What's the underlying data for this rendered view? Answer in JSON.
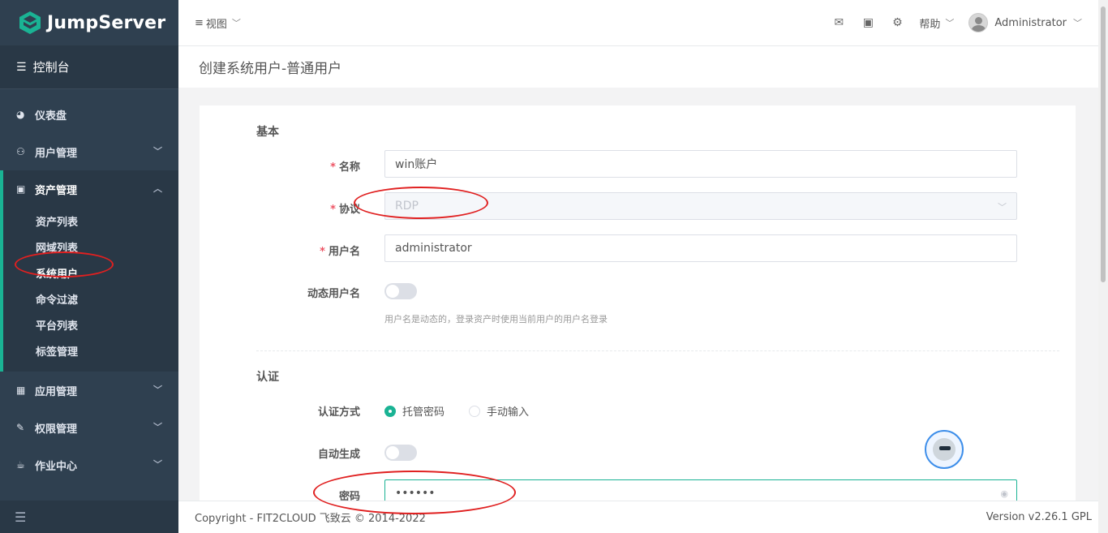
{
  "sidebar": {
    "logo_text": "JumpServer",
    "console_label": "控制台",
    "items": [
      {
        "label": "仪表盘",
        "icon": "dashboard-icon"
      },
      {
        "label": "用户管理",
        "icon": "users-icon"
      },
      {
        "label": "资产管理",
        "icon": "inbox-icon",
        "expanded": true
      },
      {
        "label": "应用管理",
        "icon": "grid-icon"
      },
      {
        "label": "权限管理",
        "icon": "edit-icon"
      },
      {
        "label": "作业中心",
        "icon": "coffee-icon"
      }
    ],
    "asset_sub": [
      "资产列表",
      "网域列表",
      "系统用户",
      "命令过滤",
      "平台列表",
      "标签管理"
    ],
    "active_sub": "系统用户"
  },
  "topbar": {
    "view_label": "视图",
    "help_label": "帮助",
    "user_name": "Administrator"
  },
  "page": {
    "title": "创建系统用户-普通用户"
  },
  "form": {
    "section_basic": "基本",
    "name_label": "名称",
    "name_value": "win账户",
    "protocol_label": "协议",
    "protocol_value": "RDP",
    "username_label": "用户名",
    "username_value": "administrator",
    "dynamic_user_label": "动态用户名",
    "dynamic_user_hint": "用户名是动态的，登录资产时使用当前用户的用户名登录",
    "section_auth": "认证",
    "auth_method_label": "认证方式",
    "auth_options": [
      "托管密码",
      "手动输入"
    ],
    "auth_selected": "托管密码",
    "auto_gen_label": "自动生成",
    "password_label": "密码",
    "password_value": "••••••"
  },
  "footer": {
    "copyright": "Copyright - FIT2CLOUD 飞致云 © 2014-2022",
    "version": "Version v2.26.1 GPL"
  },
  "colors": {
    "sidebar_bg": "#2f4050",
    "accent": "#1ab394",
    "annotation": "#e02020"
  }
}
